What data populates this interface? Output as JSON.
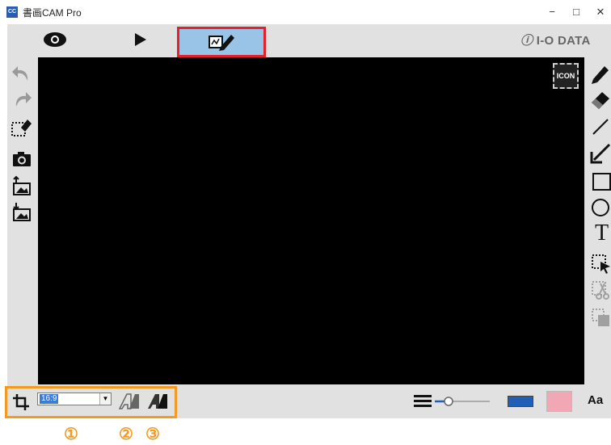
{
  "window": {
    "title": "書画CAM Pro",
    "app_icon_text": "CC",
    "minimize": "−",
    "maximize": "□",
    "close": "✕"
  },
  "toolbar": {
    "brand": "I-O DATA",
    "modes": [
      {
        "name": "camera-view",
        "icon": "eye-icon",
        "active": false
      },
      {
        "name": "playback",
        "icon": "play-icon",
        "active": false
      },
      {
        "name": "drawing",
        "icon": "draw-pen-icon",
        "active": true
      }
    ]
  },
  "canvas": {
    "icon_button_label": "ICON",
    "background": "#000000"
  },
  "left_tools": [
    {
      "name": "undo",
      "icon": "undo-icon",
      "enabled": false
    },
    {
      "name": "redo",
      "icon": "redo-icon",
      "enabled": false
    },
    {
      "name": "erase-selection",
      "icon": "area-eraser-icon",
      "enabled": true
    },
    {
      "name": "snapshot",
      "icon": "camera-icon",
      "enabled": true
    },
    {
      "name": "import-image",
      "icon": "image-import-icon",
      "enabled": true
    },
    {
      "name": "export-image",
      "icon": "image-export-icon",
      "enabled": true
    }
  ],
  "right_tools": [
    {
      "name": "pen",
      "icon": "pencil-icon",
      "enabled": true
    },
    {
      "name": "eraser",
      "icon": "eraser-icon",
      "enabled": true
    },
    {
      "name": "line",
      "icon": "line-icon",
      "enabled": true
    },
    {
      "name": "arrow",
      "icon": "arrow-icon",
      "enabled": true
    },
    {
      "name": "rectangle",
      "icon": "rectangle-icon",
      "enabled": true
    },
    {
      "name": "ellipse",
      "icon": "circle-icon",
      "enabled": true
    },
    {
      "name": "text",
      "icon": "text-icon",
      "glyph": "T",
      "enabled": true
    },
    {
      "name": "select",
      "icon": "select-pointer-icon",
      "enabled": true
    },
    {
      "name": "cut",
      "icon": "scissors-icon",
      "enabled": false
    },
    {
      "name": "paste",
      "icon": "paste-icon",
      "enabled": false
    }
  ],
  "bottom_bar": {
    "crop_icon": "crop-icon",
    "aspect_ratio": "16:9",
    "text_recognize_icon": "font-outline-icon",
    "text_bold_icon": "font-bold-icon",
    "line_width_level": 0.25,
    "pen_color": "#1f5fb6",
    "fill_color": "#f2a7b4",
    "font_button_label": "Aa"
  },
  "colors": {
    "accent_frame": "#e4212b",
    "callout": "#f39a22",
    "mode_active_bg": "#99c4e8"
  },
  "callouts": [
    "①",
    "②",
    "③"
  ]
}
